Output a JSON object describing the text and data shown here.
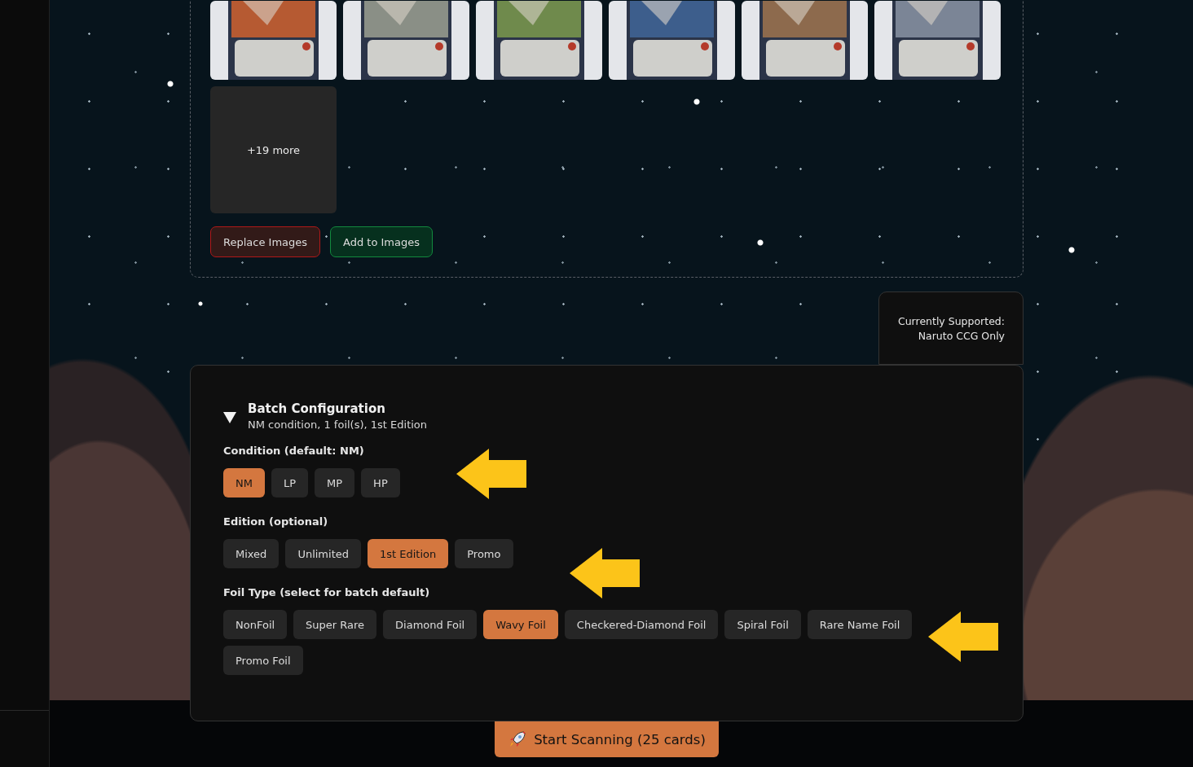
{
  "upload": {
    "more_label": "+19 more",
    "buttons": [
      {
        "label": "Replace Images",
        "kind": "danger"
      },
      {
        "label": "Add to Images",
        "kind": "success"
      }
    ]
  },
  "support_note": [
    "Currently Supported:",
    "Naruto CCG Only"
  ],
  "batch_config": {
    "title": "Batch Configuration",
    "expanded": true,
    "summary": "NM condition, 1 foil(s), 1st Edition",
    "groups": [
      {
        "label": "Condition (default: NM)",
        "options": [
          {
            "label": "NM",
            "selected": true
          },
          {
            "label": "LP",
            "selected": false
          },
          {
            "label": "MP",
            "selected": false
          },
          {
            "label": "HP",
            "selected": false
          }
        ]
      },
      {
        "label": "Edition (optional)",
        "options": [
          {
            "label": "Mixed",
            "selected": false
          },
          {
            "label": "Unlimited",
            "selected": false
          },
          {
            "label": "1st Edition",
            "selected": true
          },
          {
            "label": "Promo",
            "selected": false
          }
        ]
      },
      {
        "label": "Foil Type (select for batch default)",
        "options": [
          {
            "label": "NonFoil",
            "selected": false
          },
          {
            "label": "Super Rare",
            "selected": false
          },
          {
            "label": "Diamond Foil",
            "selected": false
          },
          {
            "label": "Wavy Foil",
            "selected": true
          },
          {
            "label": "Checkered-Diamond Foil",
            "selected": false
          },
          {
            "label": "Spiral Foil",
            "selected": false
          },
          {
            "label": "Rare Name Foil",
            "selected": false
          },
          {
            "label": "Promo Foil",
            "selected": false
          }
        ]
      }
    ]
  },
  "start_button": {
    "label": "Start Scanning (25 cards)"
  }
}
